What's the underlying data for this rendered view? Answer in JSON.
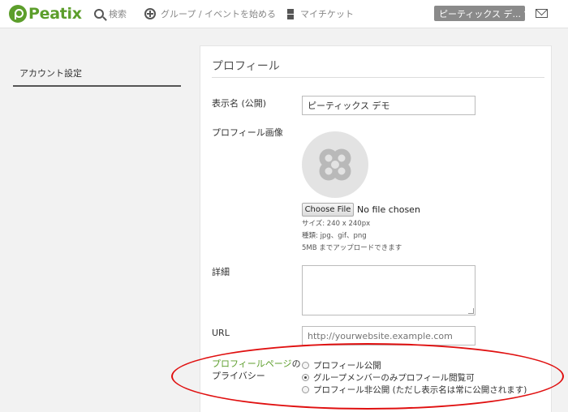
{
  "header": {
    "logo": "Peatix",
    "nav": {
      "search": "検索",
      "create": "グループ / イベントを始める",
      "tickets": "マイチケット"
    },
    "user_menu": "ピーティックス デ..."
  },
  "sidebar": {
    "items": [
      {
        "label": "アカウント設定"
      }
    ]
  },
  "profile": {
    "title": "プロフィール",
    "display_name_label": "表示名 (公開)",
    "display_name_value": "ピーティックス デモ",
    "image_label": "プロフィール画像",
    "choose_file": "Choose File",
    "file_status": "No file chosen",
    "hint_size": "サイズ: 240 x 240px",
    "hint_types": "種類: jpg、gif、png",
    "hint_upload": "5MB までアップロードできます",
    "details_label": "詳細",
    "url_label": "URL",
    "url_placeholder": "http://yourwebsite.example.com",
    "privacy_label_link": "プロフィールページ",
    "privacy_label_rest1": "の",
    "privacy_label_line2": "プライバシー",
    "privacy_options": [
      {
        "label": "プロフィール公開",
        "checked": false
      },
      {
        "label": "グループメンバーのみプロフィール閲覧可",
        "checked": true
      },
      {
        "label": "プロフィール非公開 (ただし表示名は常に公開されます)",
        "checked": false
      }
    ]
  },
  "colors": {
    "brand": "#5c9e2b",
    "annotation": "#e01010"
  }
}
